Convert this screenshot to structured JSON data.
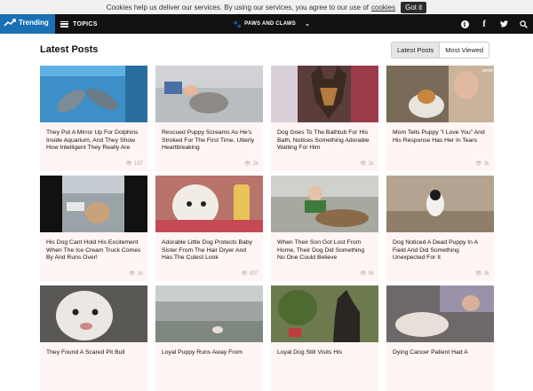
{
  "cookie": {
    "message": "Cookies help us deliver our services. By using our services, you agree to our use of",
    "link": "cookies",
    "button": "Got it"
  },
  "nav": {
    "trending": "Trending",
    "topics": "TOPICS",
    "brand": "PAWS AND CLAWS",
    "icons": [
      "info-icon",
      "facebook-icon",
      "twitter-icon",
      "search-icon"
    ]
  },
  "page": {
    "title": "Latest Posts",
    "tabs": [
      "Latest Posts",
      "Most Viewed"
    ]
  },
  "posts": [
    {
      "title": "They Put A Mirror Up For Dolphins Inside Aquarium, And They Show How Intelligent They Really Are",
      "views": "187"
    },
    {
      "title": "Rescued Puppy Screams As He's Stroked For The First Time, Utterly Heartbreaking",
      "views": "2k"
    },
    {
      "title": "Dog Goes To The Bathtub For His Bath, Notices Something Adorable Waiting For Him",
      "views": "1k"
    },
    {
      "title": "Mom Tells Puppy \"I Love You\" And His Response Has Her In Tears",
      "views": "3k"
    },
    {
      "title": "His Dog Cant Hold His Excitement When The Ice Cream Truck Comes By And Runs Over!",
      "views": "1k"
    },
    {
      "title": "Adorable Little Dog Protects Baby Sister From The Hair Dryer And Has The Cutest Look",
      "views": "837"
    },
    {
      "title": "When Their Son Got Lost From Home, Their Dog Did Something No One Could Believe",
      "views": "9k"
    },
    {
      "title": "Dog Noticed A Dead Puppy In A Field And Did Something Unexpected For It",
      "views": "3k"
    },
    {
      "title": "They Found A Scared Pit Bull",
      "views": ""
    },
    {
      "title": "Loyal Puppy Runs Away From",
      "views": ""
    },
    {
      "title": "Loyal Dog Still Visits His",
      "views": ""
    },
    {
      "title": "Dying Cancer Patient Had A",
      "views": ""
    }
  ],
  "thumb_watermark": "petsk"
}
